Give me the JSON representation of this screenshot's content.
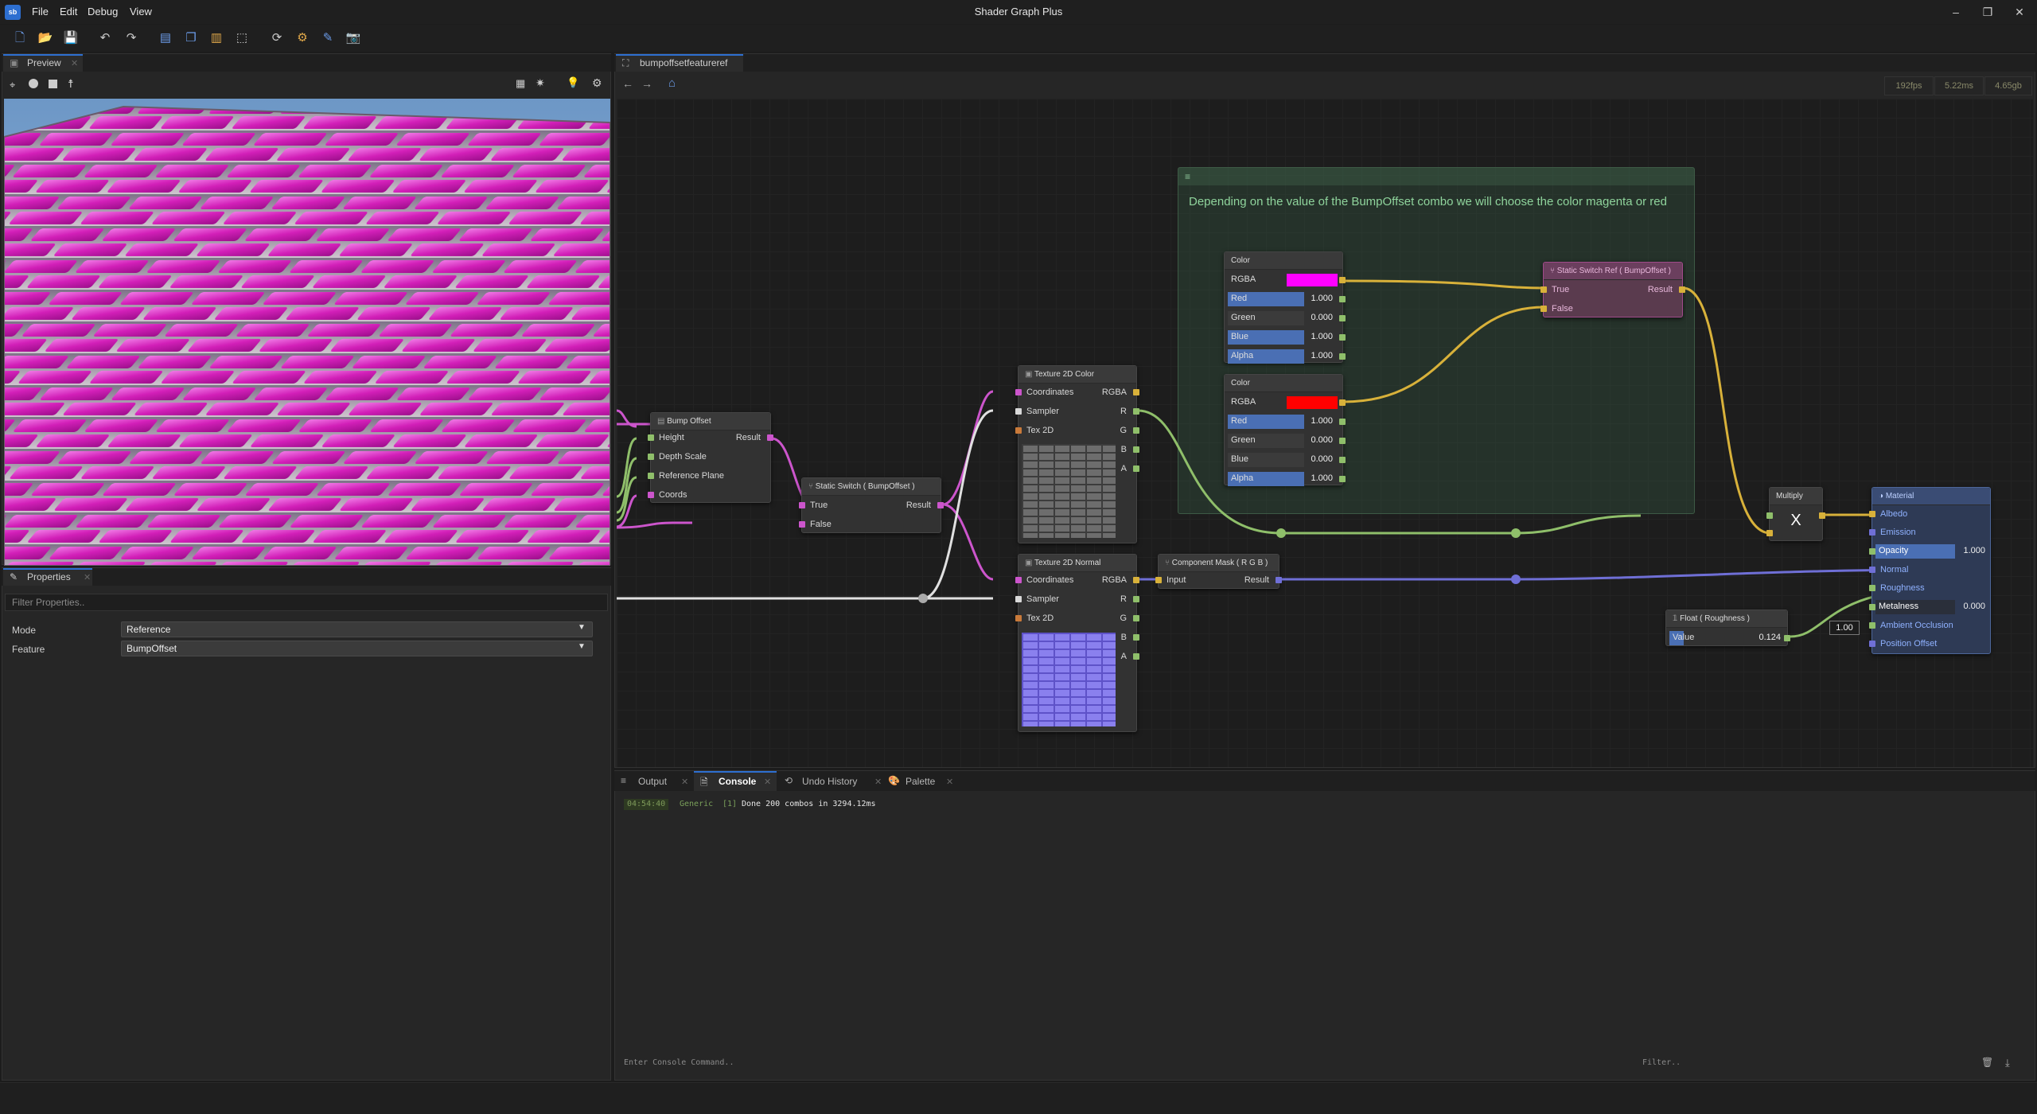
{
  "app": {
    "logo": "sb",
    "title": "Shader Graph Plus",
    "menu": [
      "File",
      "Edit",
      "Debug",
      "View"
    ]
  },
  "window_controls": {
    "minimize": "–",
    "restore": "❐",
    "close": "✕"
  },
  "preview": {
    "tab": "Preview"
  },
  "properties": {
    "tab": "Properties",
    "filter_placeholder": "Filter Properties..",
    "rows": [
      {
        "label": "Mode",
        "value": "Reference"
      },
      {
        "label": "Feature",
        "value": "BumpOffset"
      }
    ]
  },
  "graph": {
    "tab": "bumpoffsetfeatureref",
    "stats": {
      "fps": "192fps",
      "frame_time": "5.22ms",
      "memory": "4.65gb"
    },
    "comment": "Depending on the value of the BumpOffset combo we will choose the color magenta or red",
    "nodes": {
      "bump_offset": {
        "title": "Bump Offset",
        "inputs": [
          "Height",
          "Depth Scale",
          "Reference Plane",
          "Coords"
        ],
        "output": "Result"
      },
      "static_switch": {
        "title": "Static Switch ( BumpOffset )",
        "inputs": [
          "True",
          "False"
        ],
        "output": "Result"
      },
      "tex_color": {
        "title": "Texture 2D Color",
        "inputs": [
          "Coordinates",
          "Sampler",
          "Tex 2D"
        ],
        "outputs": [
          "RGBA",
          "R",
          "G",
          "B",
          "A"
        ]
      },
      "tex_normal": {
        "title": "Texture 2D Normal",
        "inputs": [
          "Coordinates",
          "Sampler",
          "Tex 2D"
        ],
        "outputs": [
          "RGBA",
          "R",
          "G",
          "B",
          "A"
        ]
      },
      "component_mask": {
        "title": "Component Mask ( R G B )",
        "input": "Input",
        "output": "Result"
      },
      "color_magenta": {
        "title": "Color",
        "swatch": "#ff00ff",
        "rgba_label": "RGBA",
        "fields": [
          {
            "label": "Red",
            "value": "1.000"
          },
          {
            "label": "Green",
            "value": "0.000"
          },
          {
            "label": "Blue",
            "value": "1.000"
          },
          {
            "label": "Alpha",
            "value": "1.000"
          }
        ]
      },
      "color_red": {
        "title": "Color",
        "swatch": "#ff0000",
        "rgba_label": "RGBA",
        "fields": [
          {
            "label": "Red",
            "value": "1.000"
          },
          {
            "label": "Green",
            "value": "0.000"
          },
          {
            "label": "Blue",
            "value": "0.000"
          },
          {
            "label": "Alpha",
            "value": "1.000"
          }
        ]
      },
      "static_switch_ref": {
        "title": "Static Switch Ref ( BumpOffset )",
        "inputs": [
          "True",
          "False"
        ],
        "output": "Result"
      },
      "multiply": {
        "title": "Multiply",
        "symbol": "X"
      },
      "float_roughness": {
        "title": "Float ( Roughness )",
        "label": "Value",
        "value": "0.124",
        "fill": 0.124
      },
      "inline_value": "1.00",
      "material": {
        "title": "Material",
        "inputs": [
          "Albedo",
          "Emission",
          "Opacity",
          "Normal",
          "Roughness",
          "Metalness",
          "Ambient Occlusion",
          "Position Offset"
        ],
        "opacity": "1.000",
        "metalness": "0.000"
      }
    }
  },
  "console": {
    "tabs": [
      "Output",
      "Console",
      "Undo History",
      "Palette"
    ],
    "active_tab": "Console",
    "lines": [
      {
        "time": "04:54:40",
        "category": "Generic",
        "count": "[1]",
        "message": "Done 200 combos in 3294.12ms"
      }
    ],
    "input_placeholder": "Enter Console Command..",
    "filter_placeholder": "Filter.."
  },
  "colors": {
    "accent": "#2d6fd0",
    "wire_yellow": "#d8b13a",
    "wire_green": "#8fbf6a",
    "wire_pink": "#cc55cc",
    "wire_blue": "#6f6fd6",
    "wire_white": "#e0e0e0"
  }
}
